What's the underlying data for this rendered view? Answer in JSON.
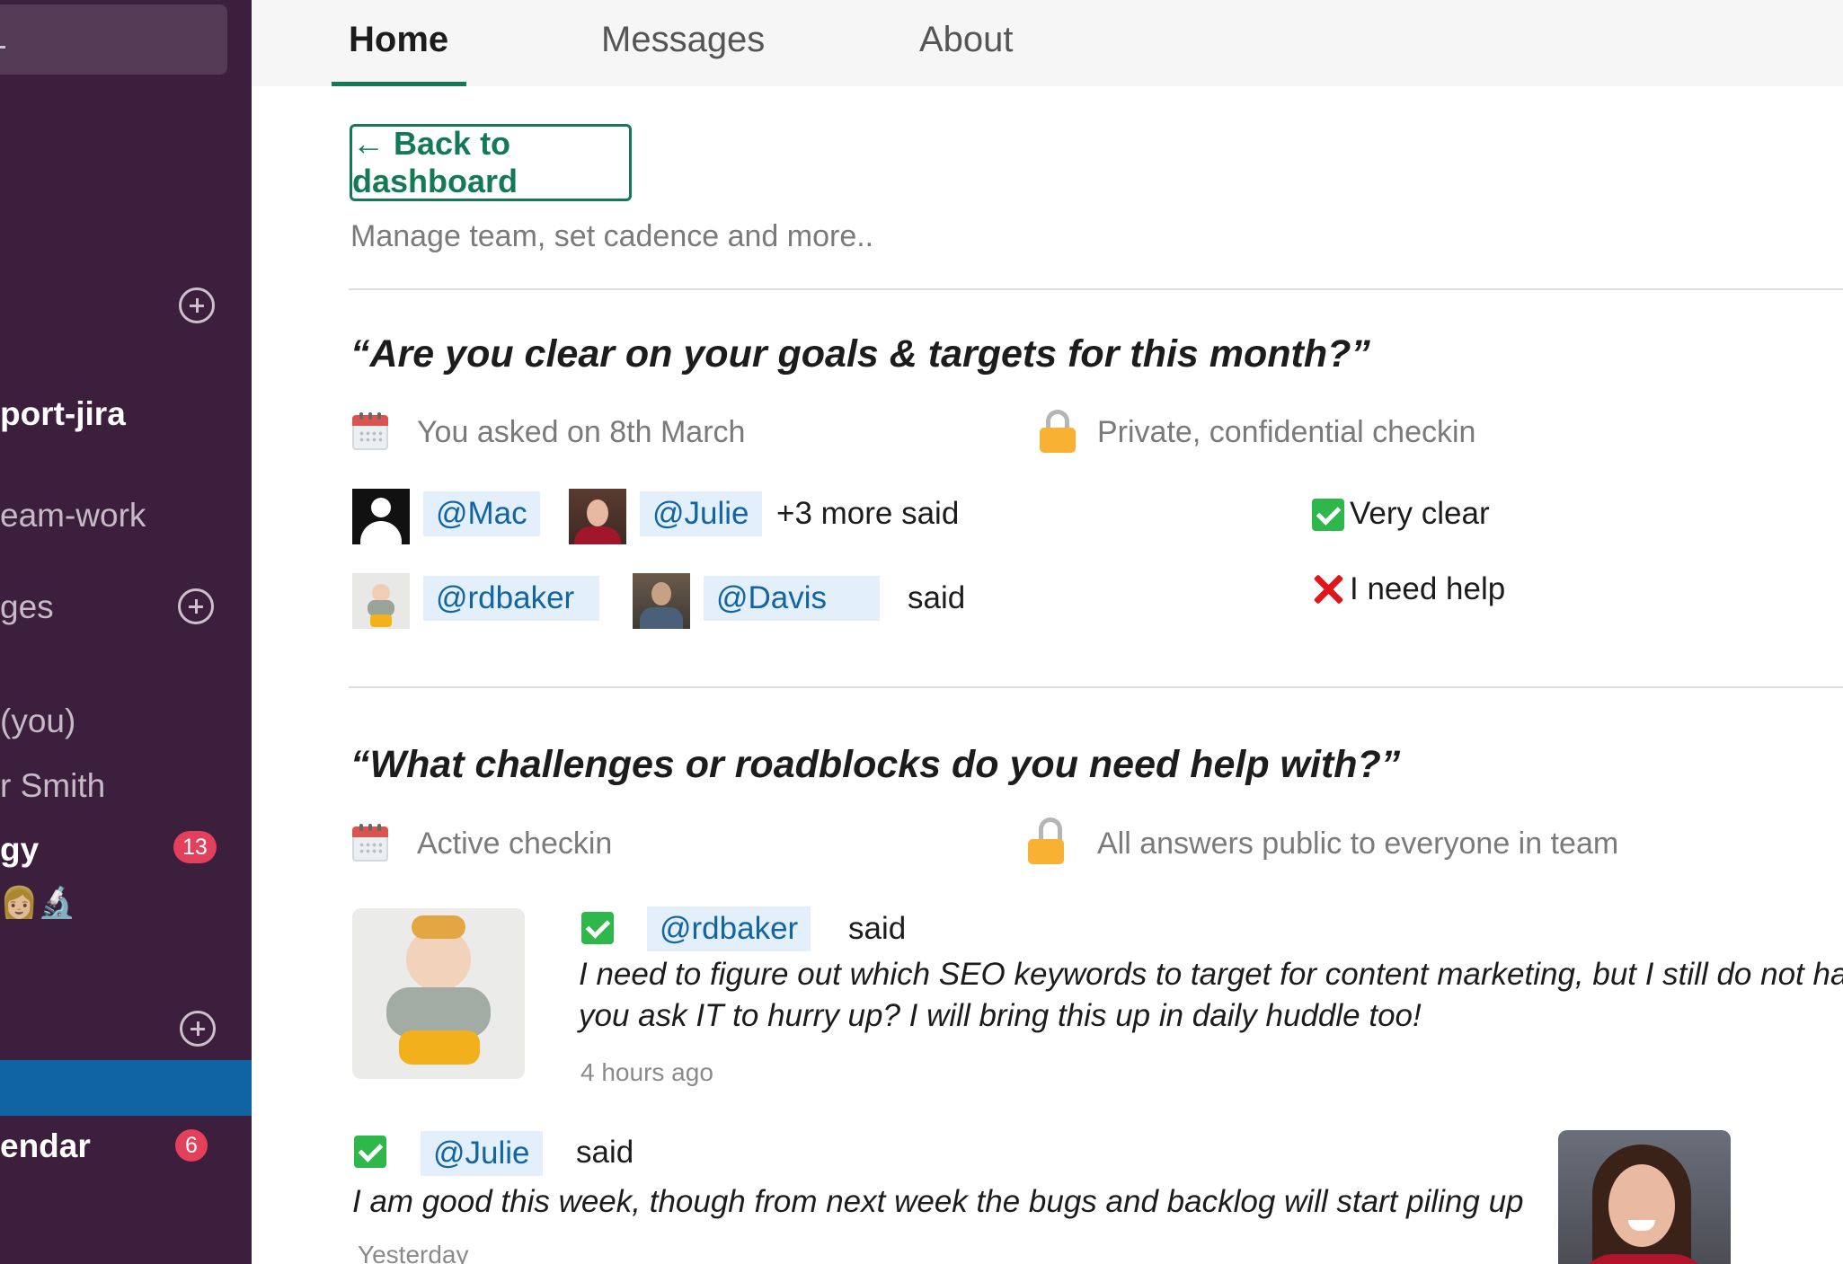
{
  "sidebar": {
    "items": [
      {
        "label": "port-jira",
        "bold": true
      },
      {
        "label": "eam-work",
        "bold": false
      },
      {
        "label": "ges",
        "bold": false
      },
      {
        "label": "(you)",
        "bold": false
      },
      {
        "label": "r Smith",
        "bold": false
      },
      {
        "label": "gy",
        "bold": true,
        "badge": "13"
      },
      {
        "label": "endar",
        "bold": true,
        "badge": "6"
      }
    ],
    "emoji": "👩🏼🔬"
  },
  "tabs": [
    {
      "label": "Home",
      "active": true
    },
    {
      "label": "Messages",
      "active": false
    },
    {
      "label": "About",
      "active": false
    }
  ],
  "main": {
    "back_button": "← Back to dashboard",
    "subtitle": "Manage team, set cadence and more.."
  },
  "checkins": [
    {
      "question": "“Are you clear on your goals & targets for this month?”",
      "date_text": "You asked on 8th March",
      "privacy_text": "Private, confidential checkin",
      "rows": [
        {
          "mentions": [
            "@Mac",
            "@Julie"
          ],
          "suffix": "+3 more said",
          "status": "Very clear",
          "status_icon": "check-icon"
        },
        {
          "mentions": [
            "@rdbaker",
            "@Davis"
          ],
          "suffix": "said",
          "status": "I need help",
          "status_icon": "cross-icon"
        }
      ]
    },
    {
      "question": "“What challenges or roadblocks do you need help with?”",
      "date_text": "Active checkin",
      "privacy_text": "All answers public to everyone in team",
      "answers": [
        {
          "mention": "@rdbaker",
          "suffix": "said",
          "text_line1": "I need to figure out which SEO keywords to target for content marketing, but I still do not ha",
          "text_line2": "you ask IT to hurry up? I will bring this up in daily huddle too!",
          "time": "4 hours ago"
        },
        {
          "mention": "@Julie",
          "suffix": "said",
          "text_line1": "I am good this week, though from next week the bugs and backlog will start piling up",
          "time": "Yesterday"
        }
      ]
    }
  ],
  "colors": {
    "sidebar_bg": "#3b1f3c",
    "accent_green": "#147a55",
    "mention_blue": "#1264a3",
    "mention_bg": "#e3f0fb",
    "badge_red": "#e3405b",
    "active_blue": "#1164a3"
  }
}
